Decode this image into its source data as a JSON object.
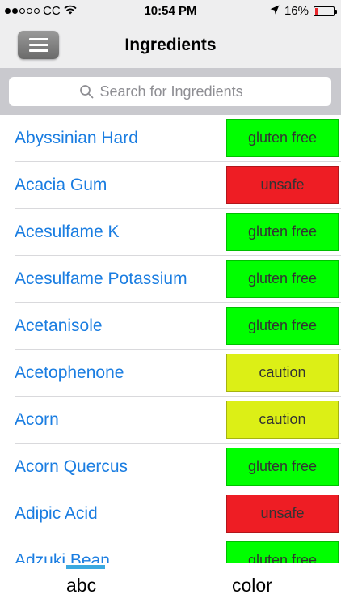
{
  "status_bar": {
    "carrier": "CC",
    "time": "10:54 PM",
    "battery_percent": "16%",
    "battery_level": 0.16,
    "signal_bars_filled": 2,
    "signal_bars_total": 5
  },
  "nav": {
    "title": "Ingredients"
  },
  "search": {
    "placeholder": "Search for Ingredients",
    "value": ""
  },
  "colors": {
    "gluten_free": "#00ff00",
    "unsafe": "#ee1d24",
    "caution": "#dcef16",
    "link_blue": "#1a7de1",
    "tab_indicator": "#3aa9e0"
  },
  "ingredients": [
    {
      "name": "Abyssinian Hard",
      "status": "gluten free",
      "kind": "gluten_free"
    },
    {
      "name": "Acacia Gum",
      "status": "unsafe",
      "kind": "unsafe"
    },
    {
      "name": "Acesulfame K",
      "status": "gluten free",
      "kind": "gluten_free"
    },
    {
      "name": "Acesulfame Potassium",
      "status": "gluten free",
      "kind": "gluten_free"
    },
    {
      "name": "Acetanisole",
      "status": "gluten free",
      "kind": "gluten_free"
    },
    {
      "name": "Acetophenone",
      "status": "caution",
      "kind": "caution"
    },
    {
      "name": "Acorn",
      "status": "caution",
      "kind": "caution"
    },
    {
      "name": "Acorn Quercus",
      "status": "gluten free",
      "kind": "gluten_free"
    },
    {
      "name": "Adipic Acid",
      "status": "unsafe",
      "kind": "unsafe"
    },
    {
      "name": "Adzuki Bean",
      "status": "gluten free",
      "kind": "gluten_free"
    }
  ],
  "tabs": {
    "abc_label": "abc",
    "color_label": "color",
    "selected": "abc"
  }
}
